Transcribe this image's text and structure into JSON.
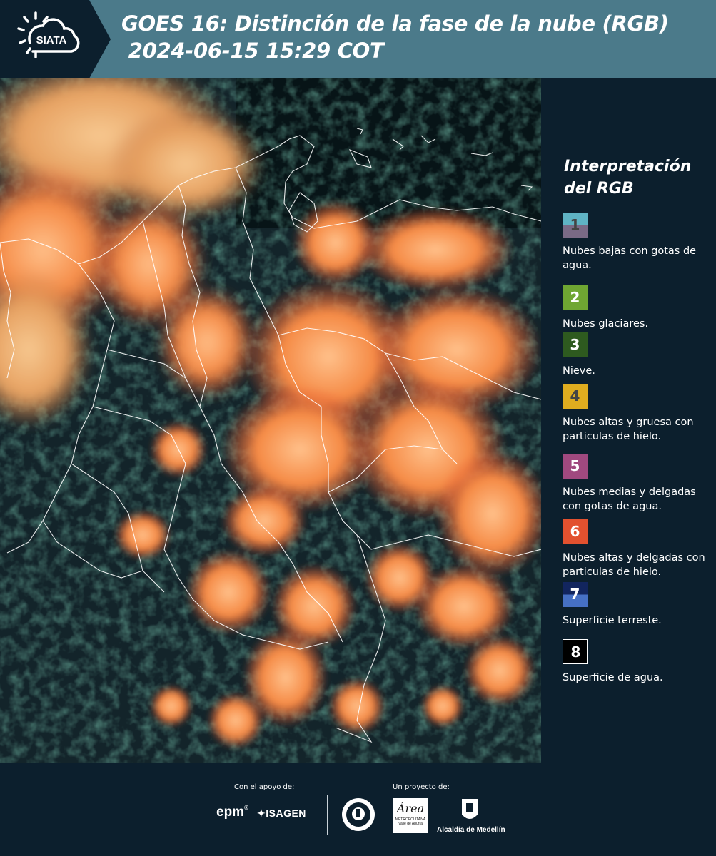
{
  "header": {
    "logo_text": "SIATA",
    "title_line1": "GOES 16: Distinción de la fase de la nube (RGB)",
    "title_line2": " 2024-06-15 15:29 COT"
  },
  "legend": {
    "title_line1": "Interpretación",
    "title_line2": "del RGB",
    "items": [
      {
        "number": "1",
        "label": "Nubes bajas con gotas de agua.",
        "color_top": "#5fb3c4",
        "color_bottom": "#7a6a86",
        "text_color": "#444444"
      },
      {
        "number": "2",
        "label": "Nubes glaciares.",
        "color_top": "#6fa632",
        "color_bottom": "#6fa632",
        "text_color": "#ffffff"
      },
      {
        "number": "3",
        "label": "Nieve.",
        "color_top": "#2e5a1f",
        "color_bottom": "#2e5a1f",
        "text_color": "#ffffff"
      },
      {
        "number": "4",
        "label": "Nubes altas y gruesa con particulas de hielo.",
        "color_top": "#e0ad1f",
        "color_bottom": "#e0ad1f",
        "text_color": "#444444"
      },
      {
        "number": "5",
        "label": "Nubes medias y delgadas con gotas de agua.",
        "color_top": "#a0497f",
        "color_bottom": "#a0497f",
        "text_color": "#ffffff"
      },
      {
        "number": "6",
        "label": "Nubes altas y delgadas con particulas de hielo.",
        "color_top": "#e2512f",
        "color_bottom": "#e2512f",
        "text_color": "#ffffff"
      },
      {
        "number": "7",
        "label": "Superficie terreste.",
        "color_top": "#12255e",
        "color_bottom": "#4670c4",
        "text_color": "#ffffff"
      },
      {
        "number": "8",
        "label": "Superficie de agua.",
        "color_top": "#000000",
        "color_bottom": "#000000",
        "text_color": "#ffffff"
      }
    ]
  },
  "footer": {
    "support_label": "Con el apoyo de:",
    "project_label": "Un proyecto de:",
    "partner_epm": "epm",
    "partner_isagen": "ISAGEN",
    "partner_area": "Área",
    "partner_area_sub1": "METROPOLITANA",
    "partner_area_sub2": "Valle de Aburrá",
    "partner_alcaldia": "Alcaldía de Medellín"
  },
  "colors": {
    "header_bg": "#4b7a8a",
    "page_bg": "#0c1f2d",
    "cloud_orange": "#f27a3a"
  }
}
